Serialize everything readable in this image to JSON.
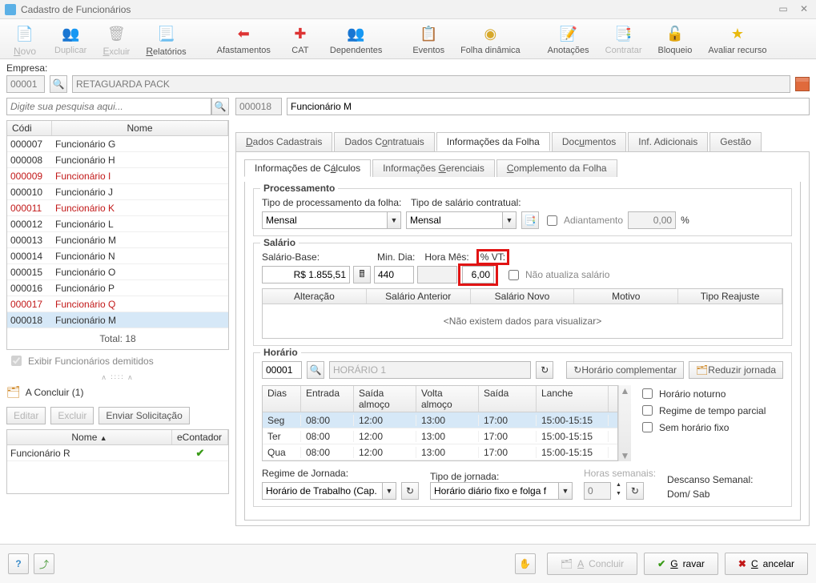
{
  "window": {
    "title": "Cadastro de Funcionários"
  },
  "toolbar": {
    "novo": "Novo",
    "duplicar": "Duplicar",
    "excluir": "Excluir",
    "relatorios": "Relatórios",
    "afastamentos": "Afastamentos",
    "cat": "CAT",
    "dependentes": "Dependentes",
    "eventos": "Eventos",
    "folha": "Folha dinâmica",
    "anotacoes": "Anotações",
    "contratar": "Contratar",
    "bloqueio": "Bloqueio",
    "avaliar": "Avaliar recurso"
  },
  "empresa": {
    "label": "Empresa:",
    "code": "00001",
    "name": "RETAGUARDA PACK"
  },
  "left": {
    "search_placeholder": "Digite sua pesquisa aqui...",
    "col_codigo": "Códi",
    "col_nome": "Nome",
    "rows": [
      {
        "code": "000007",
        "name": "Funcionário G",
        "red": false
      },
      {
        "code": "000008",
        "name": "Funcionário H",
        "red": false
      },
      {
        "code": "000009",
        "name": "Funcionário I",
        "red": true
      },
      {
        "code": "000010",
        "name": "Funcionário J",
        "red": false
      },
      {
        "code": "000011",
        "name": "Funcionário K",
        "red": true
      },
      {
        "code": "000012",
        "name": "Funcionário L",
        "red": false
      },
      {
        "code": "000013",
        "name": "Funcionário M",
        "red": false
      },
      {
        "code": "000014",
        "name": "Funcionário N",
        "red": false
      },
      {
        "code": "000015",
        "name": "Funcionário O",
        "red": false
      },
      {
        "code": "000016",
        "name": "Funcionário P",
        "red": false
      },
      {
        "code": "000017",
        "name": "Funcionário Q",
        "red": true
      },
      {
        "code": "000018",
        "name": "Funcionário M",
        "red": false
      }
    ],
    "total": "Total: 18",
    "chk_demitidos": "Exibir Funcionários demitidos",
    "a_concluir": "A Concluir (1)",
    "editar": "Editar",
    "excluir": "Excluir",
    "enviar": "Enviar Solicitação",
    "col_nome2": "Nome",
    "col_econt": "eContador",
    "pend_rows": [
      {
        "name": "Funcionário R"
      }
    ]
  },
  "right": {
    "code": "000018",
    "name": "Funcionário M",
    "tabs": [
      "Dados Cadastrais",
      "Dados Contratuais",
      "Informações da Folha",
      "Documentos",
      "Inf. Adicionais",
      "Gestão"
    ],
    "subtabs": [
      "Informações de Cálculos",
      "Informações Gerenciais",
      "Complemento da Folha"
    ],
    "proc": {
      "legend": "Processamento",
      "tipo_proc_lbl": "Tipo de processamento da folha:",
      "tipo_proc_val": "Mensal",
      "tipo_sal_lbl": "Tipo de salário contratual:",
      "tipo_sal_val": "Mensal",
      "adiant_lbl": "Adiantamento",
      "adiant_val": "0,00",
      "pct": "%"
    },
    "sal": {
      "legend": "Salário",
      "base_lbl": "Salário-Base:",
      "base_val": "R$ 1.855,51",
      "min_lbl": "Min. Dia:",
      "min_val": "440",
      "hora_lbl": "Hora Mês:",
      "hora_val": "",
      "vt_lbl": "% VT:",
      "vt_val": "6,00",
      "nao_atualiza": "Não atualiza salário",
      "cols": [
        "Alteração",
        "Salário Anterior",
        "Salário Novo",
        "Motivo",
        "Tipo Reajuste"
      ],
      "empty": "<Não existem dados para visualizar>"
    },
    "hor": {
      "legend": "Horário",
      "code": "00001",
      "name": "HORÁRIO 1",
      "btn_comp": "Horário complementar",
      "btn_red": "Reduzir jornada",
      "cols": [
        "Dias",
        "Entrada",
        "Saída almoço",
        "Volta almoço",
        "Saída",
        "Lanche"
      ],
      "rows": [
        {
          "d": "Seg",
          "e": "08:00",
          "sa": "12:00",
          "va": "13:00",
          "s": "17:00",
          "l": "15:00-15:15"
        },
        {
          "d": "Ter",
          "e": "08:00",
          "sa": "12:00",
          "va": "13:00",
          "s": "17:00",
          "l": "15:00-15:15"
        },
        {
          "d": "Qua",
          "e": "08:00",
          "sa": "12:00",
          "va": "13:00",
          "s": "17:00",
          "l": "15:00-15:15"
        }
      ],
      "chk_noturno": "Horário noturno",
      "chk_parcial": "Regime de tempo parcial",
      "chk_semfixo": "Sem horário fixo",
      "regime_lbl": "Regime de Jornada:",
      "regime_val": "Horário de Trabalho (Cap.",
      "tipoj_lbl": "Tipo de jornada:",
      "tipoj_val": "Horário diário fixo e folga f",
      "horas_lbl": "Horas semanais:",
      "horas_val": "0",
      "desc_lbl": "Descanso Semanal:",
      "desc_val": "Dom/ Sab"
    }
  },
  "footer": {
    "a_concluir": "A Concluir",
    "gravar": "Gravar",
    "cancelar": "Cancelar"
  }
}
